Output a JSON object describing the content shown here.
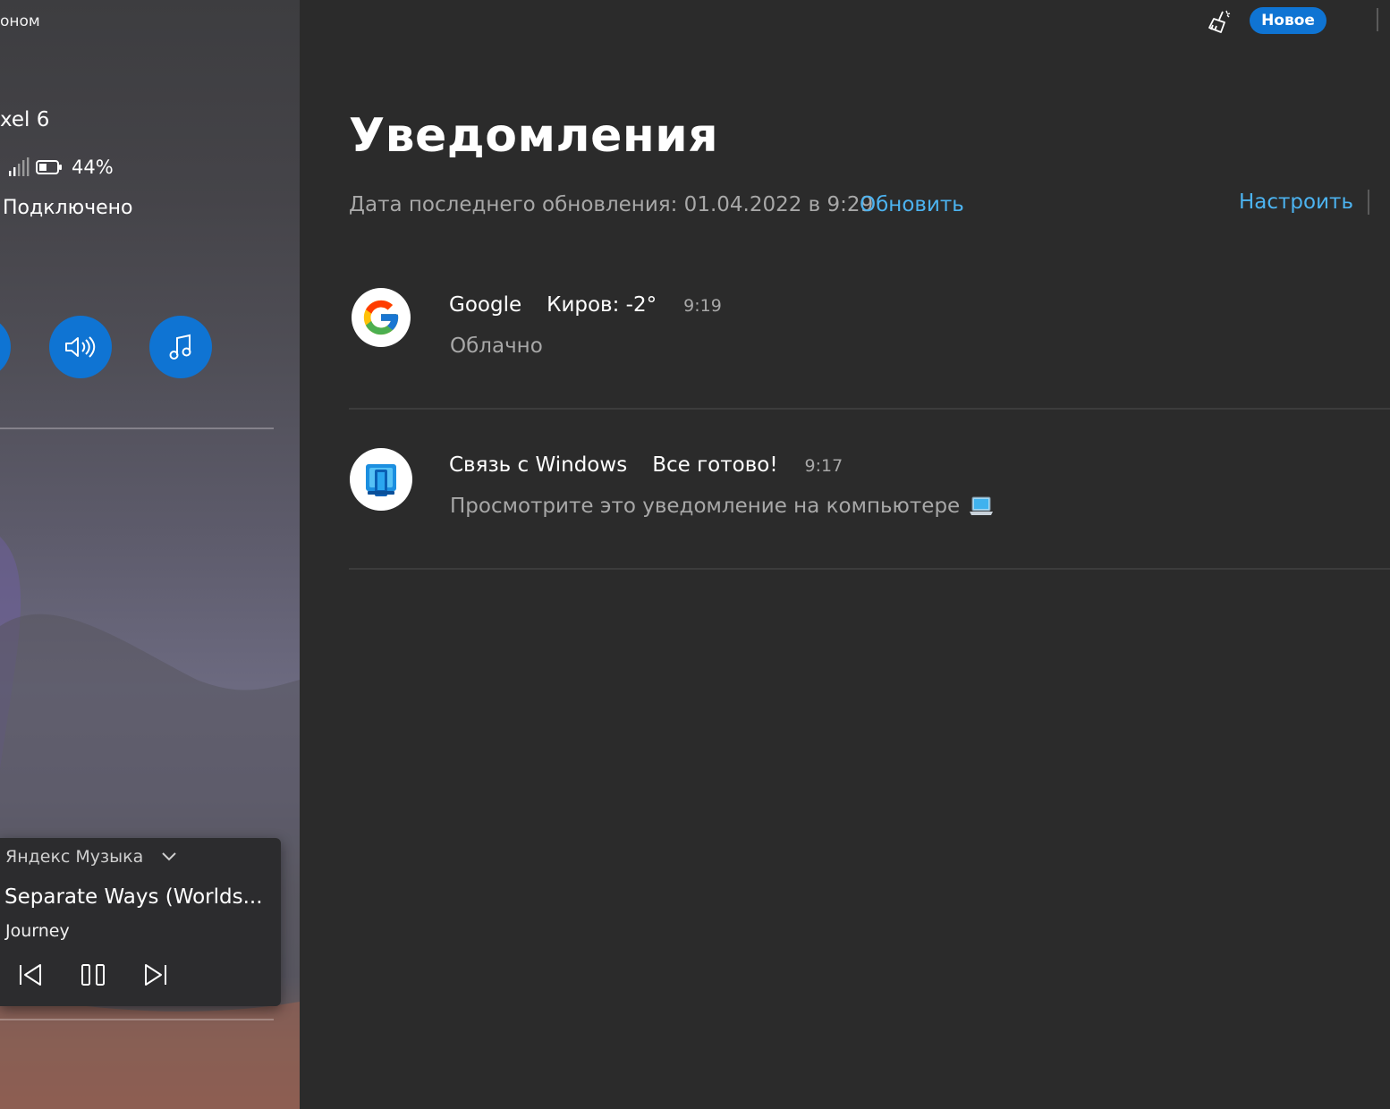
{
  "phone": {
    "top_label": "оном",
    "device_name": "xel 6",
    "battery_percent": "44%",
    "battery_level": 0.44,
    "connection_status": "Подключено"
  },
  "quick_actions": [
    {
      "icon": "partial-circle-button"
    },
    {
      "icon": "speaker-icon"
    },
    {
      "icon": "music-note-icon"
    }
  ],
  "media": {
    "app_name": "Яндекс Музыка",
    "track_title": "Separate Ways (Worlds...",
    "artist": "Journey"
  },
  "topbar": {
    "new_badge": "Новое"
  },
  "notifications_page": {
    "title": "Уведомления",
    "last_updated": "Дата последнего обновления: 01.04.2022 в 9:29",
    "refresh_label": "Обновить",
    "settings_label": "Настроить"
  },
  "notifications": [
    {
      "icon": "google-icon",
      "app": "Google",
      "title": "Киров: -2°",
      "time": "9:19",
      "body": "Облачно"
    },
    {
      "icon": "phone-link-icon",
      "app": "Связь с Windows",
      "title": "Все готово!",
      "time": "9:17",
      "body": "Просмотрите это уведомление на компьютере",
      "body_emoji": "laptop-emoji"
    }
  ],
  "colors": {
    "accent": "#0f74d3",
    "link": "#4cb3f0",
    "background": "#2b2b2b"
  }
}
